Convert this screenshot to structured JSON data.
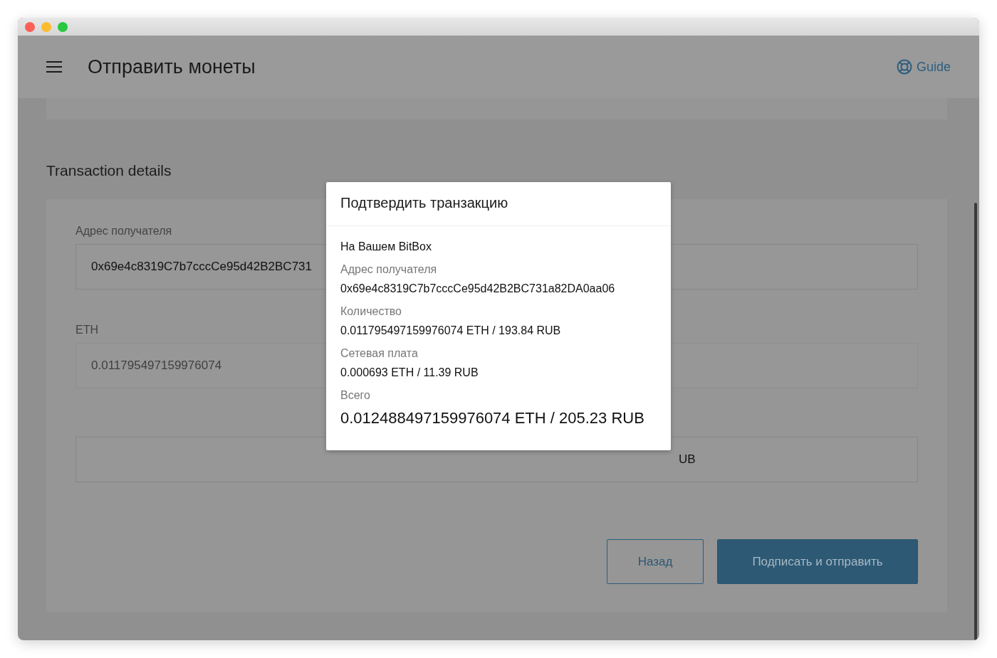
{
  "header": {
    "title": "Отправить монеты",
    "guide_label": "Guide"
  },
  "section_title": "Transaction details",
  "fields": [
    {
      "label": "Адрес получателя",
      "value": "0x69e4c8319C7b7cccCe95d42B2BC731",
      "disabled": false,
      "kind": "left"
    },
    {
      "label": "ETH",
      "value": "0.011795497159976074",
      "disabled": true,
      "kind": "left"
    },
    {
      "value": "UB",
      "disabled": false,
      "kind": "right"
    }
  ],
  "buttons": [
    {
      "label": "Назад",
      "kind": "secondary"
    },
    {
      "label": "Подписать и отправить",
      "kind": "primary"
    }
  ],
  "modal": {
    "title": "Подтвердить транзакцию",
    "device_line": "На Вашем BitBox",
    "rows": [
      {
        "label": "Адрес получателя",
        "value": "0x69e4c8319C7b7cccCe95d42B2BC731a82DA0aa06"
      },
      {
        "label": "Количество",
        "value": "0.011795497159976074 ETH / 193.84 RUB"
      },
      {
        "label": "Сетевая плата",
        "value": "0.000693 ETH / 11.39 RUB"
      }
    ],
    "total": {
      "label": "Всего",
      "value": "0.012488497159976074 ETH / 205.23 RUB"
    }
  }
}
